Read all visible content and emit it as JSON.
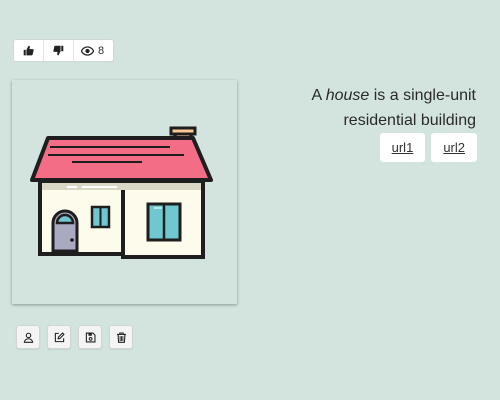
{
  "toolbar": {
    "like_icon": "thumbs-up-icon",
    "dislike_icon": "thumbs-down-icon",
    "views_icon": "eye-icon",
    "views_count": "8"
  },
  "image": {
    "subject": "house illustration",
    "colors": {
      "background": "#d3e4df",
      "roof": "#f26d85",
      "chimney": "#f9c896",
      "wall": "#fdfbec",
      "door": "#a9a9bf",
      "window": "#6fc7d0",
      "outline": "#1e1e1e"
    }
  },
  "description": {
    "prefix": "A ",
    "emphasis": "house",
    "suffix": " is a single-unit residential building"
  },
  "links": [
    {
      "label": "url1"
    },
    {
      "label": "url2"
    }
  ],
  "actions": [
    {
      "icon": "user-icon"
    },
    {
      "icon": "edit-icon"
    },
    {
      "icon": "save-icon"
    },
    {
      "icon": "trash-icon"
    }
  ]
}
